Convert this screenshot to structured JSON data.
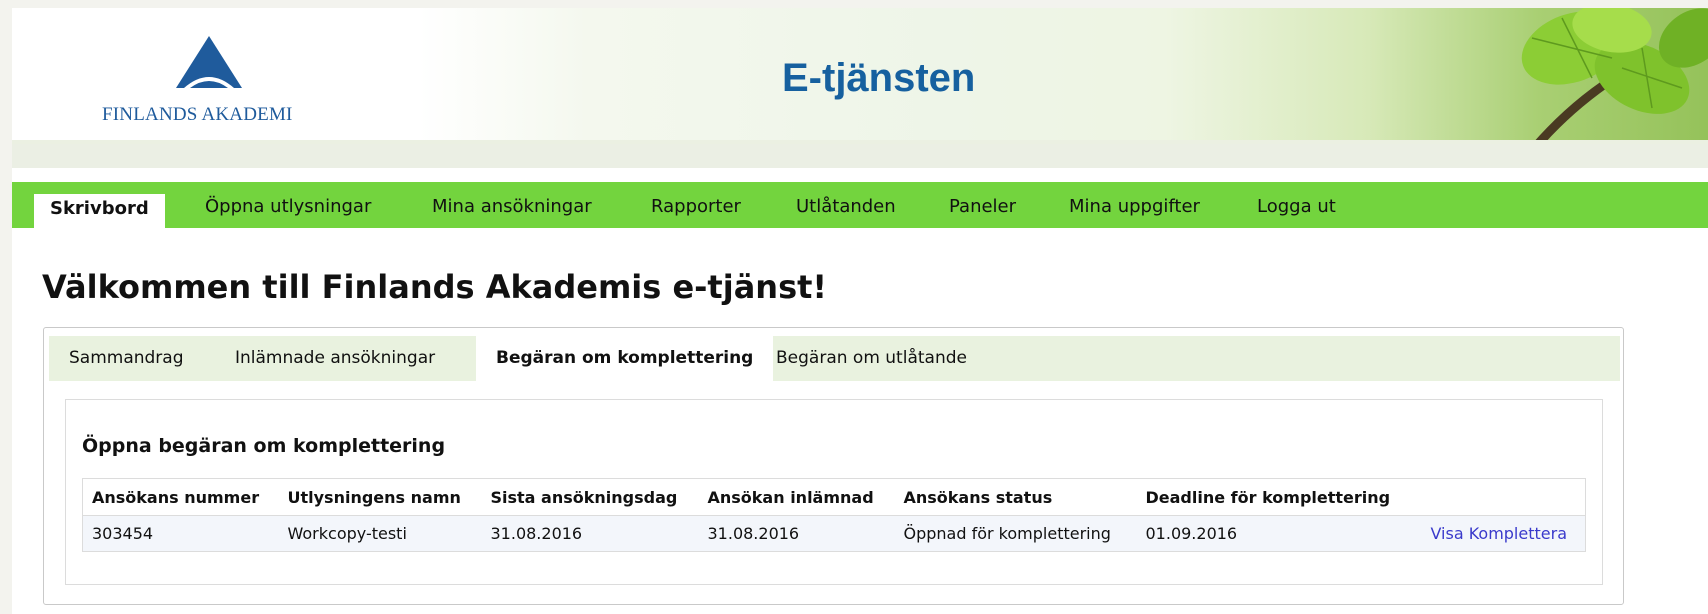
{
  "header": {
    "logo_text": "FINLANDS AKADEMI",
    "app_title": "E-tjänsten"
  },
  "nav": {
    "items": [
      {
        "label": "Skrivbord",
        "active": true
      },
      {
        "label": "Öppna utlysningar",
        "active": false
      },
      {
        "label": "Mina ansökningar",
        "active": false
      },
      {
        "label": "Rapporter",
        "active": false
      },
      {
        "label": "Utlåtanden",
        "active": false
      },
      {
        "label": "Paneler",
        "active": false
      },
      {
        "label": "Mina uppgifter",
        "active": false
      },
      {
        "label": "Logga ut",
        "active": false
      }
    ]
  },
  "page": {
    "welcome": "Välkommen till Finlands Akademis e-tjänst!"
  },
  "subtabs": [
    {
      "label": "Sammandrag",
      "active": false
    },
    {
      "label": "Inlämnade ansökningar",
      "active": false
    },
    {
      "label": "Begäran om komplettering",
      "active": true
    },
    {
      "label": "Begäran om utlåtande",
      "active": false
    }
  ],
  "section": {
    "title": "Öppna begäran om komplettering",
    "columns": [
      "Ansökans nummer",
      "Utlysningens namn",
      "Sista ansökningsdag",
      "Ansökan inlämnad",
      "Ansökans status",
      "Deadline för komplettering",
      ""
    ],
    "rows": [
      {
        "number": "303454",
        "call_name": "Workcopy-testi",
        "last_day": "31.08.2016",
        "submitted": "31.08.2016",
        "status": "Öppnad för komplettering",
        "deadline": "01.09.2016",
        "action": "Visa Komplettera"
      }
    ]
  },
  "colors": {
    "nav_green": "#73d43e",
    "title_blue": "#16609f",
    "link_blue": "#3a3acb",
    "subtab_bg": "#e9f2df"
  }
}
